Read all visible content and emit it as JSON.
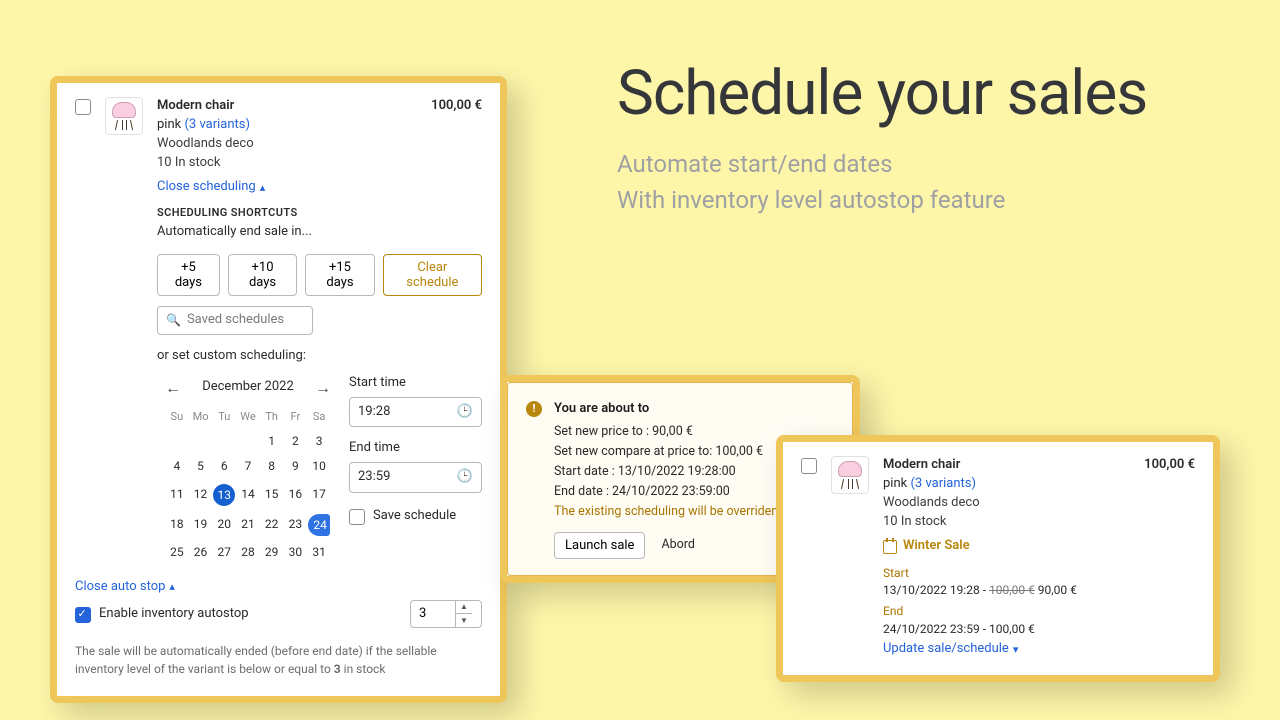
{
  "title": {
    "heading": "Schedule your sales",
    "sub1": "Automate start/end dates",
    "sub2": "With inventory level autostop feature"
  },
  "product": {
    "name": "Modern chair",
    "variant_prefix": "pink",
    "variants_link": "(3 variants)",
    "vendor": "Woodlands deco",
    "stock": "10 In stock",
    "price": "100,00 €"
  },
  "sched": {
    "close_scheduling": "Close scheduling",
    "shortcuts_caption": "SCHEDULING SHORTCUTS",
    "shortcuts_sub": "Automatically end sale in...",
    "plus5": "+5 days",
    "plus10": "+10 days",
    "plus15": "+15 days",
    "clear": "Clear schedule",
    "search_placeholder": "Saved schedules",
    "or_set": "or set custom scheduling:",
    "month": "December 2022",
    "weekdays": [
      "Su",
      "Mo",
      "Tu",
      "We",
      "Th",
      "Fr",
      "Sa"
    ],
    "start_time_label": "Start time",
    "start_time": "19:28",
    "end_time_label": "End time",
    "end_time": "23:59",
    "save_schedule": "Save schedule",
    "close_autostop": "Close auto stop",
    "enable_autostop": "Enable inventory autostop",
    "autostop_qty": "3",
    "autostop_note_a": "The sale will be automatically ended (before end date) if the sellable inventory level of the variant is below or equal to ",
    "autostop_note_b": "3",
    "autostop_note_c": " in stock"
  },
  "cal_rows": [
    [
      {
        "n": ""
      },
      {
        "n": ""
      },
      {
        "n": ""
      },
      {
        "n": ""
      },
      {
        "n": "1"
      },
      {
        "n": "2"
      },
      {
        "n": "3"
      }
    ],
    [
      {
        "n": "4"
      },
      {
        "n": "5"
      },
      {
        "n": "6"
      },
      {
        "n": "7"
      },
      {
        "n": "8"
      },
      {
        "n": "9"
      },
      {
        "n": "10"
      }
    ],
    [
      {
        "n": "11"
      },
      {
        "n": "12"
      },
      {
        "n": "13",
        "s": 1
      },
      {
        "n": "14"
      },
      {
        "n": "15"
      },
      {
        "n": "16"
      },
      {
        "n": "17"
      }
    ],
    [
      {
        "n": "18"
      },
      {
        "n": "19"
      },
      {
        "n": "20"
      },
      {
        "n": "21"
      },
      {
        "n": "22"
      },
      {
        "n": "23"
      },
      {
        "n": "24",
        "s": 2
      }
    ],
    [
      {
        "n": "25"
      },
      {
        "n": "26"
      },
      {
        "n": "27"
      },
      {
        "n": "28"
      },
      {
        "n": "29"
      },
      {
        "n": "30"
      },
      {
        "n": "31"
      }
    ]
  ],
  "confirm": {
    "title": "You are about to",
    "l1": "Set new price to : 90,00 €",
    "l2": "Set new compare at price to: 100,00 €",
    "l3": "Start date : 13/10/2022 19:28:00",
    "l4": "End date : 24/10/2022 23:59:00",
    "warn": "The existing scheduling will be overriden",
    "launch": "Launch sale",
    "abort": "Abord"
  },
  "state": {
    "winter_sale": "Winter Sale",
    "start_lbl": "Start",
    "start_line_a": "13/10/2022 19:28 - ",
    "start_line_strike": "100,00 €",
    "start_line_b": " 90,00 €",
    "end_lbl": "End",
    "end_line": "24/10/2022 23:59 - 100,00 €",
    "update_link": "Update sale/schedule"
  }
}
